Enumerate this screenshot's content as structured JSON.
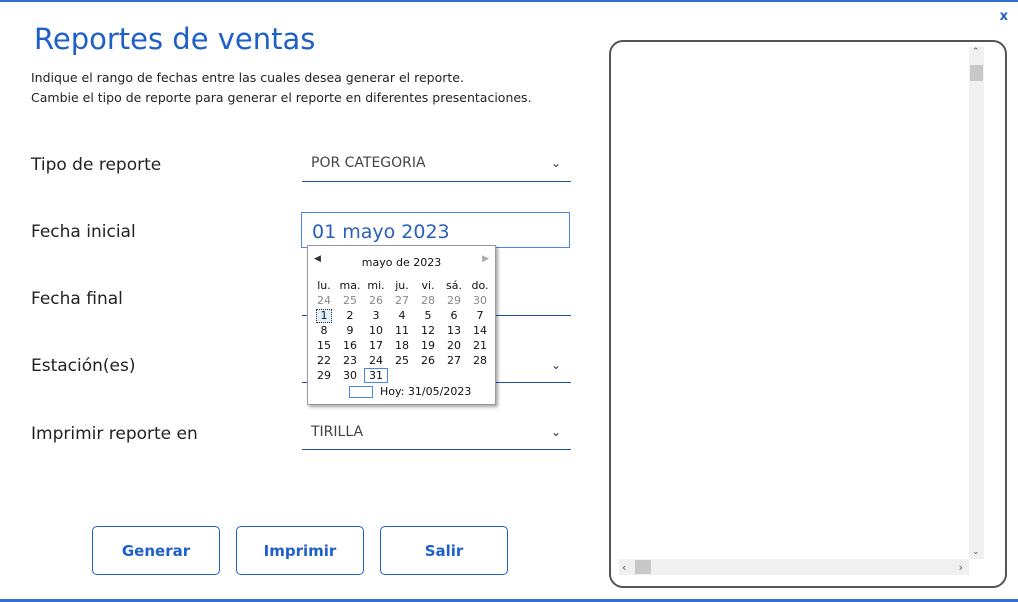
{
  "window": {
    "close_label": "x"
  },
  "header": {
    "title": "Reportes de ventas",
    "instruction_line1": "Indique el rango de fechas entre las cuales desea generar el reporte.",
    "instruction_line2": "Cambie el tipo de reporte para generar el reporte en diferentes presentaciones."
  },
  "form": {
    "tipo_label": "Tipo de reporte",
    "tipo_value": "POR CATEGORIA",
    "fecha_inicial_label": "Fecha inicial",
    "fecha_inicial_value": "01 mayo 2023",
    "fecha_final_label": "Fecha final",
    "estacion_label": "Estación(es)",
    "imprimir_label": "Imprimir reporte en",
    "imprimir_value": "TIRILLA"
  },
  "calendar": {
    "month_label": "mayo de 2023",
    "weekdays": [
      "lu.",
      "ma.",
      "mi.",
      "ju.",
      "vi.",
      "sá.",
      "do."
    ],
    "weeks": [
      [
        "24",
        "25",
        "26",
        "27",
        "28",
        "29",
        "30"
      ],
      [
        "1",
        "2",
        "3",
        "4",
        "5",
        "6",
        "7"
      ],
      [
        "8",
        "9",
        "10",
        "11",
        "12",
        "13",
        "14"
      ],
      [
        "15",
        "16",
        "17",
        "18",
        "19",
        "20",
        "21"
      ],
      [
        "22",
        "23",
        "24",
        "25",
        "26",
        "27",
        "28"
      ],
      [
        "29",
        "30",
        "31",
        "",
        "",
        "",
        ""
      ]
    ],
    "today_label": "Hoy: 31/05/2023"
  },
  "buttons": {
    "generar": "Generar",
    "imprimir": "Imprimir",
    "salir": "Salir"
  },
  "colors": {
    "accent": "#1f5fc8",
    "line": "#1f4fa0",
    "border": "#555555"
  }
}
